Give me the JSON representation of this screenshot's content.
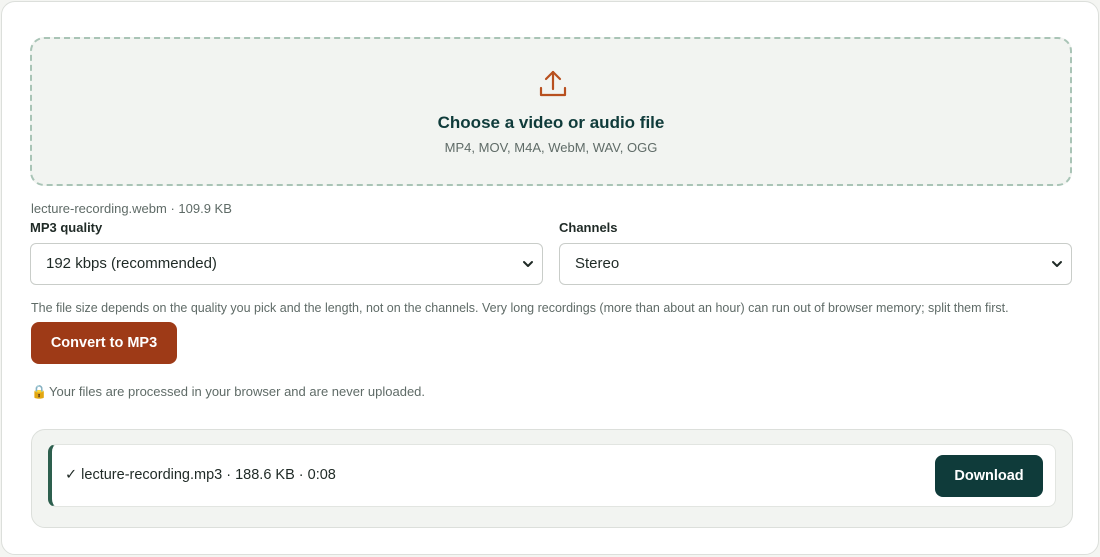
{
  "upload": {
    "icon": "upload-icon",
    "title": "Choose a video or audio file",
    "formats": "MP4, MOV, M4A, WebM, WAV, OGG"
  },
  "file_info": "lecture-recording.webm · 109.9 KB",
  "quality": {
    "label": "MP3 quality",
    "value": "192 kbps (recommended)"
  },
  "channels": {
    "label": "Channels",
    "value": "Stereo"
  },
  "note": "The file size depends on the quality you pick and the length, not on the channels. Very long recordings (more than about an hour) can run out of browser memory; split them first.",
  "convert_label": "Convert to MP3",
  "privacy": {
    "icon": "lock-icon",
    "text": "Your files are processed in your browser and are never uploaded."
  },
  "result": {
    "text": "✓ lecture-recording.mp3 · 188.6 KB · 0:08",
    "download_label": "Download"
  },
  "colors": {
    "accent": "#9e3a17",
    "primary_dark": "#0f3b3a",
    "dropzone_border": "#a9c4b6",
    "result_bar": "#2d5f4e"
  }
}
